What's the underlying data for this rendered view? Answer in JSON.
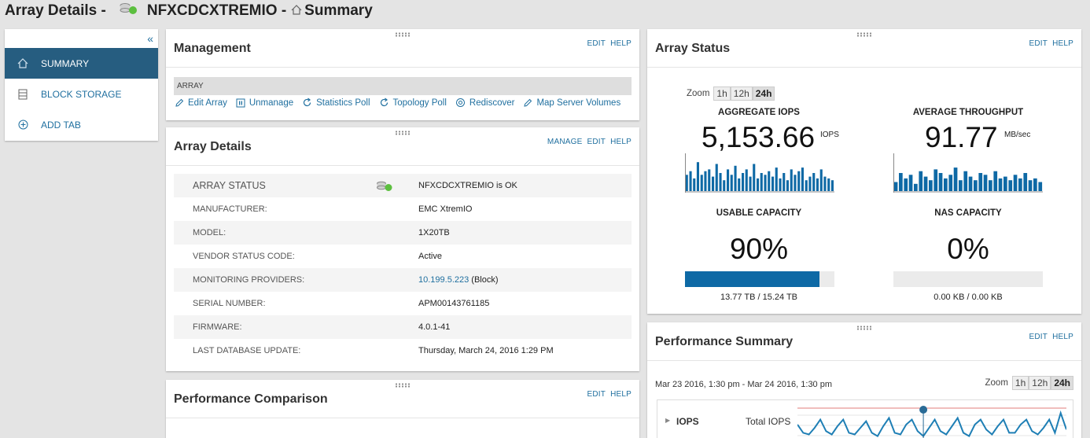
{
  "header": {
    "title": "Array Details -",
    "array_name": "NFXCDCXTREMIO -",
    "page": "Summary"
  },
  "sidebar": {
    "items": [
      {
        "label": "SUMMARY",
        "icon": "home-icon",
        "active": true
      },
      {
        "label": "BLOCK STORAGE",
        "icon": "storage-icon",
        "active": false
      },
      {
        "label": "ADD TAB",
        "icon": "plus-circle-icon",
        "active": false
      }
    ]
  },
  "management": {
    "title": "Management",
    "links": [
      "EDIT",
      "HELP"
    ],
    "bar_label": "ARRAY",
    "actions": [
      "Edit Array",
      "Unmanage",
      "Statistics Poll",
      "Topology Poll",
      "Rediscover",
      "Map Server Volumes"
    ]
  },
  "details": {
    "title": "Array Details",
    "links": [
      "MANAGE",
      "EDIT",
      "HELP"
    ],
    "rows": [
      {
        "key": "ARRAY STATUS",
        "value": "NFXCDCXTREMIO is OK"
      },
      {
        "key": "MANUFACTURER:",
        "value": "EMC XtremIO"
      },
      {
        "key": "MODEL:",
        "value": "1X20TB"
      },
      {
        "key": "VENDOR STATUS CODE:",
        "value": "Active"
      },
      {
        "key": "MONITORING PROVIDERS:",
        "link": "10.199.5.223",
        "value": " (Block)"
      },
      {
        "key": "SERIAL NUMBER:",
        "value": "APM00143761185"
      },
      {
        "key": "FIRMWARE:",
        "value": "4.0.1-41"
      },
      {
        "key": "LAST DATABASE UPDATE:",
        "value": "Thursday, March 24, 2016 1:29 PM"
      }
    ]
  },
  "comparison": {
    "title": "Performance Comparison",
    "links": [
      "EDIT",
      "HELP"
    ]
  },
  "status": {
    "title": "Array Status",
    "links": [
      "EDIT",
      "HELP"
    ],
    "zoom_label": "Zoom",
    "zoom_options": [
      "1h",
      "12h",
      "24h"
    ],
    "zoom_selected": "24h",
    "iops": {
      "label": "AGGREGATE IOPS",
      "value": "5,153.66",
      "unit": "IOPS"
    },
    "throughput": {
      "label": "AVERAGE THROUGHPUT",
      "value": "91.77",
      "unit": "MB/sec"
    },
    "usable": {
      "label": "USABLE CAPACITY",
      "value": "90%",
      "fraction": 0.9,
      "caption": "13.77 TB / 15.24 TB"
    },
    "nas": {
      "label": "NAS CAPACITY",
      "value": "0%",
      "fraction": 0.0,
      "caption": "0.00 KB / 0.00 KB"
    },
    "iops_spark": [
      0.45,
      0.55,
      0.35,
      0.8,
      0.45,
      0.55,
      0.6,
      0.4,
      0.75,
      0.5,
      0.3,
      0.6,
      0.45,
      0.7,
      0.35,
      0.5,
      0.6,
      0.4,
      0.75,
      0.35,
      0.5,
      0.45,
      0.55,
      0.4,
      0.65,
      0.35,
      0.5,
      0.3,
      0.6,
      0.45,
      0.55,
      0.65,
      0.3,
      0.4,
      0.5,
      0.35,
      0.6,
      0.4,
      0.35,
      0.3
    ],
    "tp_spark": [
      0.25,
      0.5,
      0.35,
      0.45,
      0.2,
      0.55,
      0.4,
      0.3,
      0.6,
      0.5,
      0.35,
      0.45,
      0.65,
      0.3,
      0.55,
      0.4,
      0.3,
      0.5,
      0.45,
      0.3,
      0.55,
      0.35,
      0.4,
      0.3,
      0.45,
      0.35,
      0.5,
      0.3,
      0.35,
      0.25
    ]
  },
  "performance_summary": {
    "title": "Performance Summary",
    "links": [
      "EDIT",
      "HELP"
    ],
    "range": "Mar 23 2016, 1:30 pm - Mar 24 2016, 1:30 pm",
    "zoom_label": "Zoom",
    "zoom_options": [
      "1h",
      "12h",
      "24h"
    ],
    "zoom_selected": "24h",
    "metric": "IOPS",
    "series": "Total IOPS",
    "line": [
      0.55,
      0.3,
      0.25,
      0.45,
      0.7,
      0.35,
      0.25,
      0.5,
      0.7,
      0.3,
      0.25,
      0.45,
      0.65,
      0.3,
      0.2,
      0.5,
      0.75,
      0.3,
      0.25,
      0.55,
      0.7,
      0.35,
      0.2,
      0.45,
      0.7,
      0.35,
      0.25,
      0.5,
      0.75,
      0.3,
      0.2,
      0.55,
      0.7,
      0.4,
      0.25,
      0.5,
      0.7,
      0.3,
      0.3,
      0.55,
      0.7,
      0.35,
      0.25,
      0.45,
      0.7,
      0.3,
      0.9,
      0.4
    ]
  }
}
